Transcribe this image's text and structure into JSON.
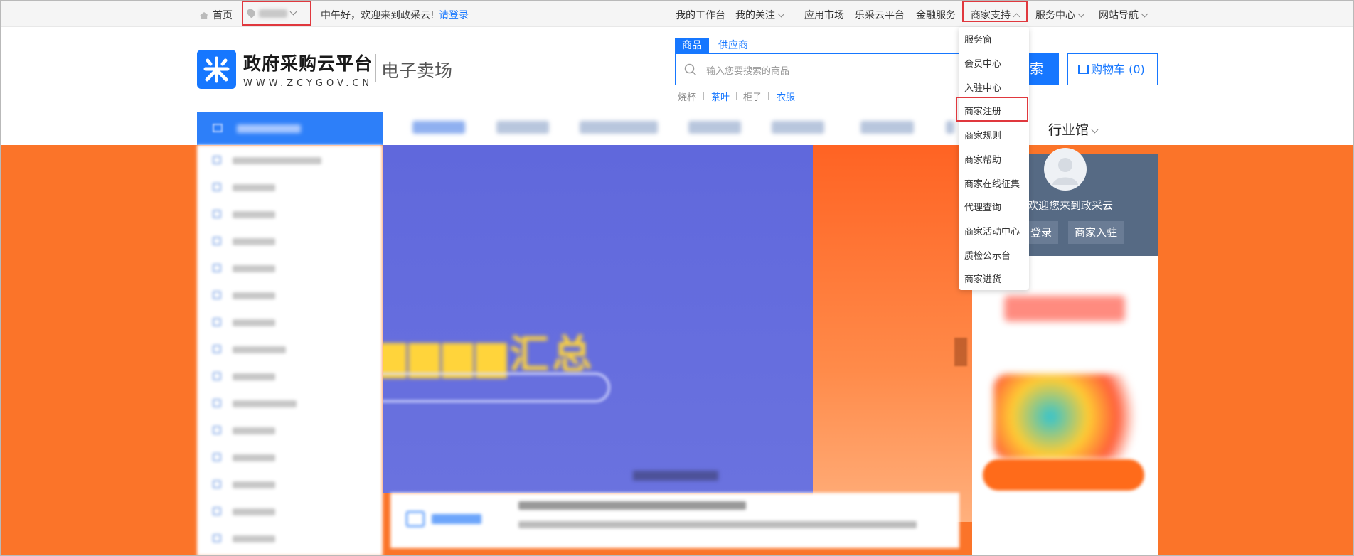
{
  "topbar": {
    "home": "首页",
    "greeting": "中午好，欢迎来到政采云!",
    "login_link": "请登录",
    "links": [
      "我的工作台",
      "我的关注",
      "应用市场",
      "乐采云平台",
      "金融服务",
      "商家支持",
      "服务中心",
      "网站导航"
    ]
  },
  "logo": {
    "title": "政府采购云平台",
    "url": "WWW.ZCYGOV.CN",
    "subtitle": "电子卖场"
  },
  "search": {
    "tabs": [
      "商品",
      "供应商"
    ],
    "placeholder": "输入您要搜索的商品",
    "button_label": "索",
    "hot_words": [
      "烧杯",
      "茶叶",
      "柜子",
      "衣服"
    ]
  },
  "cart": {
    "label": "购物车 (0)"
  },
  "nav": {
    "visible_item": "行业馆"
  },
  "dropdown": {
    "items": [
      "服务窗",
      "会员中心",
      "入驻中心",
      "商家注册",
      "商家规则",
      "商家帮助",
      "商家在线征集",
      "代理查询",
      "商家活动中心",
      "质检公示台",
      "商家进货"
    ]
  },
  "user_panel": {
    "welcome": "欢迎您来到政采云",
    "login_button": "登录",
    "join_button": "商家入驻"
  },
  "colors": {
    "primary": "#1677ff",
    "banner_orange": "#fb7429",
    "highlight_red": "#e0383e"
  }
}
